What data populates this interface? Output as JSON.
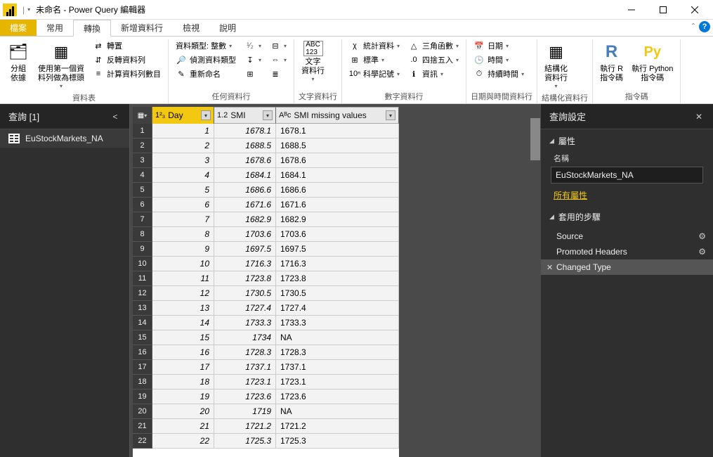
{
  "window": {
    "title": "未命名 - Power Query 編輯器",
    "qat_sep": "|"
  },
  "tabs": {
    "file": "檔案",
    "home": "常用",
    "transform": "轉換",
    "addcol": "新增資料行",
    "view": "檢視",
    "help": "說明"
  },
  "ribbon": {
    "group_table": "資料表",
    "group_anycol": "任何資料行",
    "group_textcol": "文字資料行",
    "group_numcol": "數字資料行",
    "group_datetime": "日期與時間資料行",
    "group_struct": "結構化資料行",
    "group_scripts": "指令碼",
    "groupby": "分組\n依據",
    "firstrowheader": "使用第一個資\n料列做為標頭",
    "transpose": "轉置",
    "reverserows": "反轉資料列",
    "countrows": "計算資料列數目",
    "datatype": "資料類型: 整數",
    "detecttype": "偵測資料類型",
    "rename": "重新命名",
    "textcol": "文字\n資料行",
    "stats": "統計資料",
    "standard": "標準",
    "scientific": "科學記號",
    "trig": "三角函數",
    "round": "四捨五入",
    "info": "資訊",
    "date": "日期",
    "time": "時間",
    "duration": "持續時間",
    "struct": "結構化\n資料行",
    "runR": "執行 R\n指令碼",
    "runPy": "執行 Python\n指令碼"
  },
  "queries": {
    "title": "查詢 [1]",
    "item1": "EuStockMarkets_NA"
  },
  "columns": {
    "day_type": "1²₃",
    "day": "Day",
    "smi_type": "1.2",
    "smi": "SMI",
    "miss_type": "Aᴮc",
    "miss": "SMI missing values"
  },
  "rows": [
    {
      "n": "1",
      "day": "1",
      "smi": "1678.1",
      "miss": "1678.1"
    },
    {
      "n": "2",
      "day": "2",
      "smi": "1688.5",
      "miss": "1688.5"
    },
    {
      "n": "3",
      "day": "3",
      "smi": "1678.6",
      "miss": "1678.6"
    },
    {
      "n": "4",
      "day": "4",
      "smi": "1684.1",
      "miss": "1684.1"
    },
    {
      "n": "5",
      "day": "5",
      "smi": "1686.6",
      "miss": "1686.6"
    },
    {
      "n": "6",
      "day": "6",
      "smi": "1671.6",
      "miss": "1671.6"
    },
    {
      "n": "7",
      "day": "7",
      "smi": "1682.9",
      "miss": "1682.9"
    },
    {
      "n": "8",
      "day": "8",
      "smi": "1703.6",
      "miss": "1703.6"
    },
    {
      "n": "9",
      "day": "9",
      "smi": "1697.5",
      "miss": "1697.5"
    },
    {
      "n": "10",
      "day": "10",
      "smi": "1716.3",
      "miss": "1716.3"
    },
    {
      "n": "11",
      "day": "11",
      "smi": "1723.8",
      "miss": "1723.8"
    },
    {
      "n": "12",
      "day": "12",
      "smi": "1730.5",
      "miss": "1730.5"
    },
    {
      "n": "13",
      "day": "13",
      "smi": "1727.4",
      "miss": "1727.4"
    },
    {
      "n": "14",
      "day": "14",
      "smi": "1733.3",
      "miss": "1733.3"
    },
    {
      "n": "15",
      "day": "15",
      "smi": "1734",
      "miss": "NA"
    },
    {
      "n": "16",
      "day": "16",
      "smi": "1728.3",
      "miss": "1728.3"
    },
    {
      "n": "17",
      "day": "17",
      "smi": "1737.1",
      "miss": "1737.1"
    },
    {
      "n": "18",
      "day": "18",
      "smi": "1723.1",
      "miss": "1723.1"
    },
    {
      "n": "19",
      "day": "19",
      "smi": "1723.6",
      "miss": "1723.6"
    },
    {
      "n": "20",
      "day": "20",
      "smi": "1719",
      "miss": "NA"
    },
    {
      "n": "21",
      "day": "21",
      "smi": "1721.2",
      "miss": "1721.2"
    },
    {
      "n": "22",
      "day": "22",
      "smi": "1725.3",
      "miss": "1725.3"
    }
  ],
  "settings": {
    "title": "查詢設定",
    "props": "屬性",
    "name_label": "名稱",
    "name_value": "EuStockMarkets_NA",
    "all_props": "所有屬性",
    "applied_steps": "套用的步驟",
    "step_source": "Source",
    "step_promoted": "Promoted Headers",
    "step_changed": "Changed Type"
  }
}
